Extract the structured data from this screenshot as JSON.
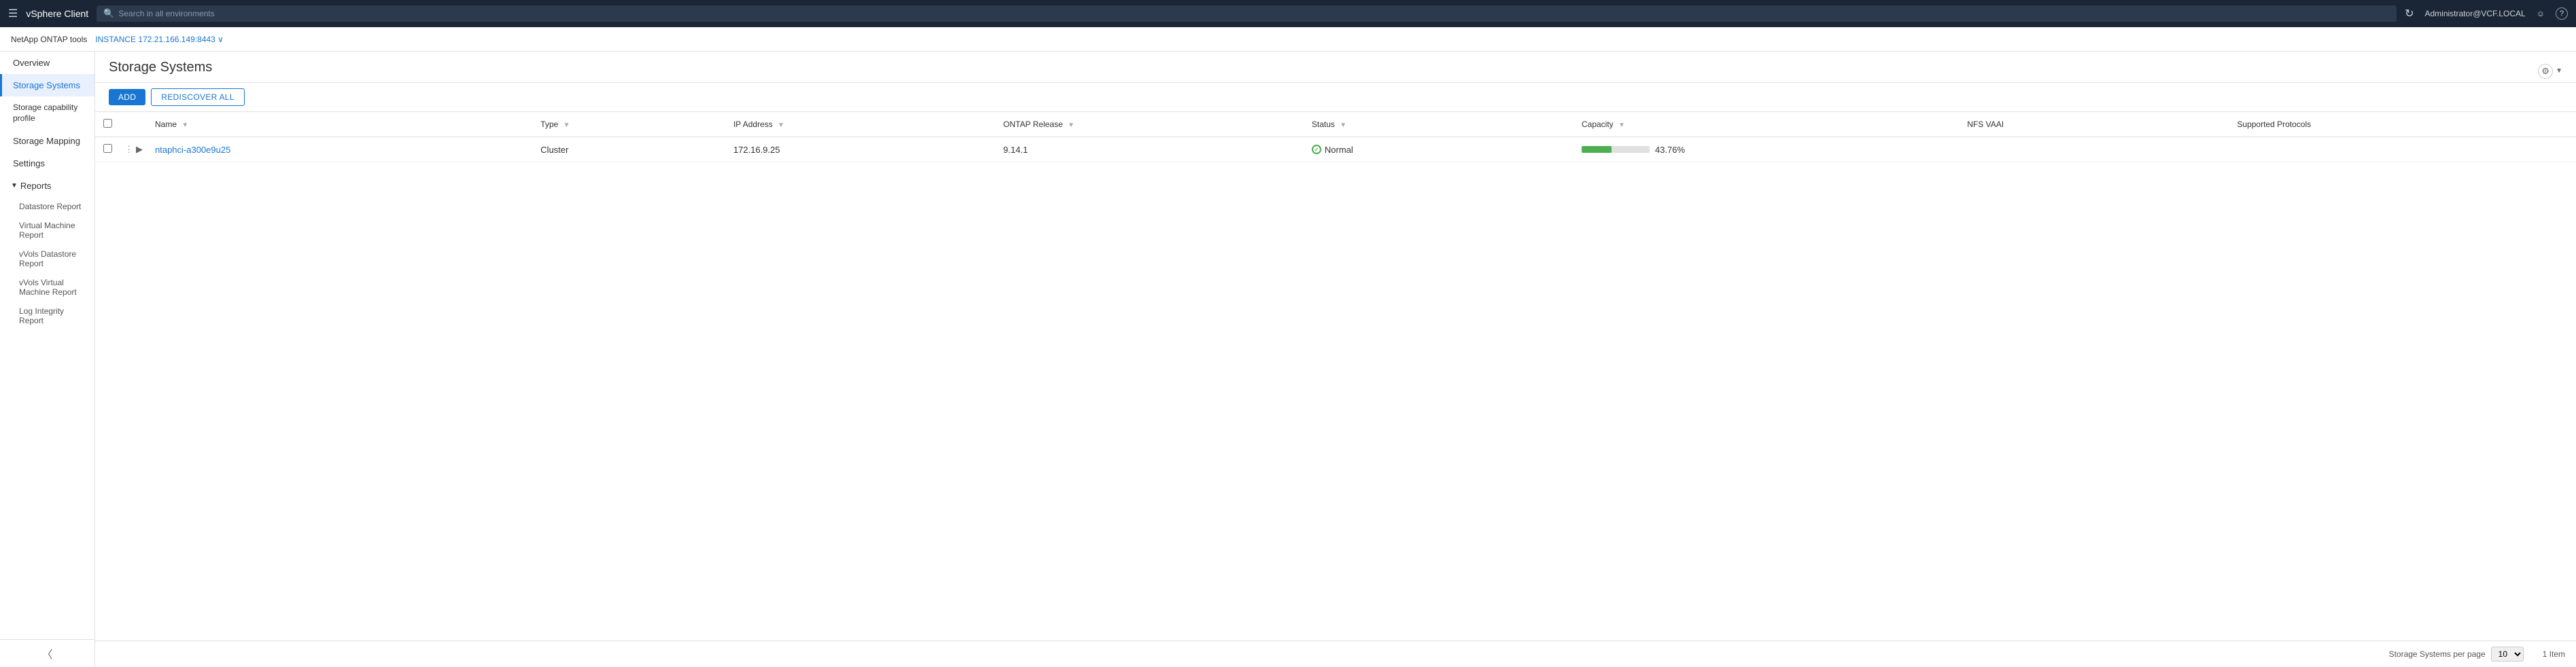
{
  "navbar": {
    "app_name": "vSphere Client",
    "search_placeholder": "Search in all environments",
    "user": "Administrator@VCF.LOCAL",
    "icons": {
      "hamburger": "☰",
      "search": "🔍",
      "refresh": "↻",
      "user": "👤",
      "face": "😊",
      "help": "?"
    }
  },
  "breadcrumb": {
    "app_label": "NetApp ONTAP tools",
    "instance_label": "INSTANCE 172.21.166.149:8443 ∨"
  },
  "sidebar": {
    "items": [
      {
        "id": "overview",
        "label": "Overview",
        "active": false
      },
      {
        "id": "storage-systems",
        "label": "Storage Systems",
        "active": true
      },
      {
        "id": "storage-capability-profile",
        "label": "Storage capability profile",
        "active": false
      },
      {
        "id": "storage-mapping",
        "label": "Storage Mapping",
        "active": false
      },
      {
        "id": "settings",
        "label": "Settings",
        "active": false
      }
    ],
    "reports_section": {
      "label": "Reports",
      "sub_items": [
        "Datastore Report",
        "Virtual Machine Report",
        "vVols Datastore Report",
        "vVols Virtual Machine Report",
        "Log Integrity Report"
      ]
    }
  },
  "page": {
    "title": "Storage Systems",
    "toolbar": {
      "add_label": "ADD",
      "rediscover_label": "REDISCOVER ALL"
    },
    "table": {
      "columns": [
        "",
        "",
        "Name",
        "Type",
        "IP Address",
        "ONTAP Release",
        "Status",
        "Capacity",
        "NFS VAAI",
        "Supported Protocols"
      ],
      "rows": [
        {
          "name": "ntaphci-a300e9u25",
          "type": "Cluster",
          "ip": "172.16.9.25",
          "ontap_release": "9.14.1",
          "status": "Normal",
          "capacity_percent": 43.76,
          "capacity_label": "43.76%",
          "nfs_vaai": "",
          "protocols": ""
        }
      ]
    },
    "footer": {
      "per_page_label": "Storage Systems per page",
      "per_page_value": "10",
      "item_count": "1 Item"
    }
  }
}
